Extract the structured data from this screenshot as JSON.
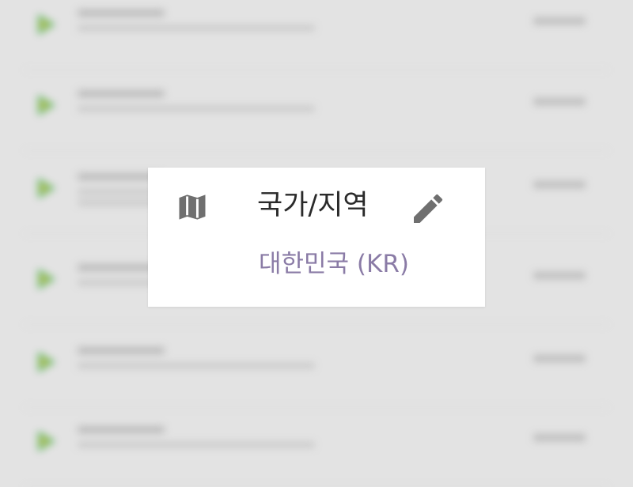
{
  "setting": {
    "label": "국가/지역",
    "value": "대한민국 (KR)",
    "leading_icon": "map-icon",
    "action_icon": "edit-pencil-icon"
  },
  "colors": {
    "card_background": "#ffffff",
    "backdrop": "#e3e3e3",
    "label_text": "#2a2a2a",
    "value_text": "#8a7ba6",
    "icon": "#6f6f6f"
  }
}
